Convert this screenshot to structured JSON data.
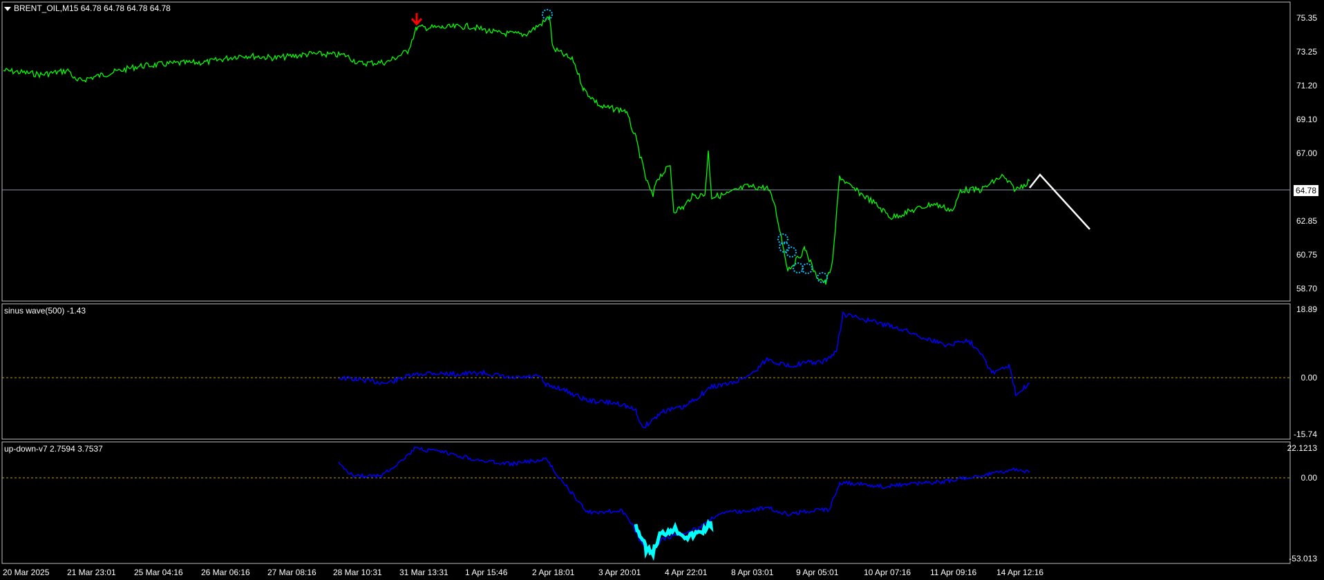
{
  "main": {
    "symbol_line": "BRENT_OIL,M15  64.78 64.78 64.78 64.78",
    "price_levels": [
      "75.35",
      "73.25",
      "71.20",
      "69.10",
      "67.00",
      "64.78",
      "62.85",
      "60.75",
      "58.70"
    ],
    "current_price": "64.78"
  },
  "indicator1": {
    "label": "sinus wave(500) -1.43",
    "levels": [
      "18.89",
      "0.00",
      "-15.74"
    ]
  },
  "indicator2": {
    "label": "up-down-v7 2.7594 3.7537",
    "levels": [
      "22.1213",
      "0.00",
      "-53.013"
    ]
  },
  "time_axis": [
    "20 Mar 2025",
    "21 Mar 23:01",
    "25 Mar 04:16",
    "26 Mar 06:16",
    "27 Mar 08:16",
    "28 Mar 10:31",
    "31 Mar 13:31",
    "1 Apr 15:46",
    "2 Apr 18:01",
    "3 Apr 20:01",
    "4 Apr 22:01",
    "8 Apr 03:01",
    "9 Apr 05:01",
    "10 Apr 07:16",
    "11 Apr 09:16",
    "14 Apr 12:16"
  ],
  "colors": {
    "price_line": "#00ff00",
    "indicator_line": "#0000ff",
    "highlight": "#00ffff",
    "zero_line": "#c8a000",
    "sell_arrow": "#ff0000",
    "forecast": "#ffffff",
    "frame": "#c0c0c0"
  }
}
